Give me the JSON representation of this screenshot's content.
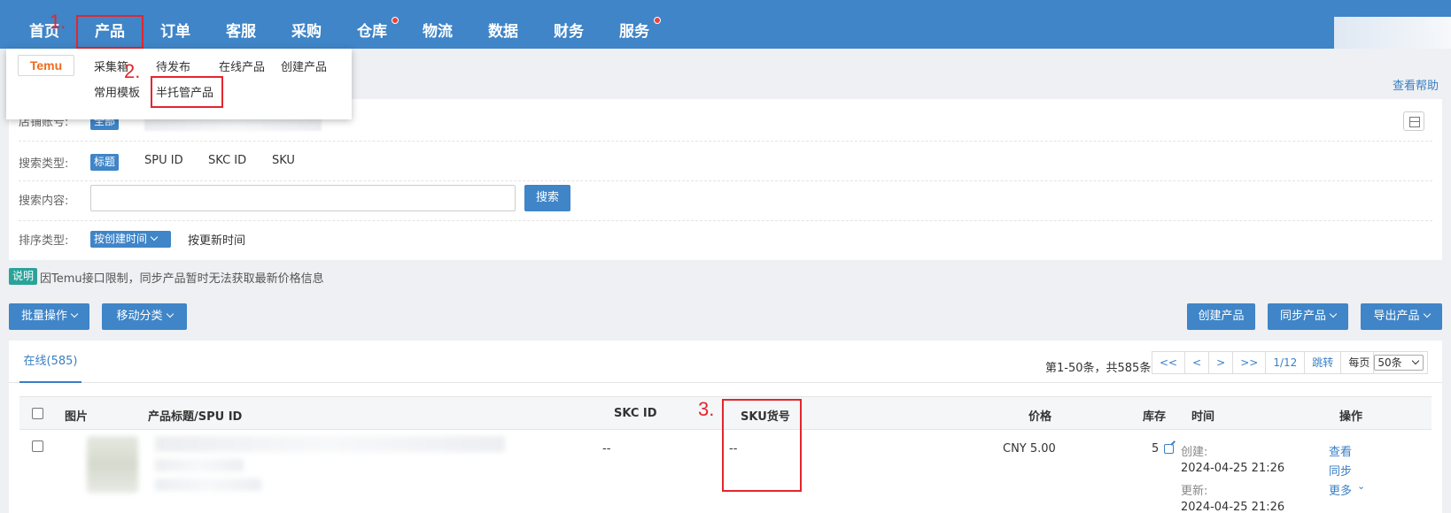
{
  "nav": {
    "items": [
      "首页",
      "产品",
      "订单",
      "客服",
      "采购",
      "仓库",
      "物流",
      "数据",
      "财务",
      "服务"
    ],
    "dots": [
      "仓库",
      "服务"
    ]
  },
  "annotations": [
    "1.",
    "2.",
    "3."
  ],
  "dropdown": {
    "platform_logo": "Temu",
    "row1": [
      "采集箱",
      "待发布",
      "在线产品",
      "创建产品"
    ],
    "row2": [
      "常用模板",
      "半托管产品"
    ]
  },
  "help_link": "查看帮助",
  "filters": {
    "shop_label": "店铺账号:",
    "shop_selected": "全部",
    "search_type_label": "搜索类型:",
    "search_types": [
      "标题",
      "SPU ID",
      "SKC ID",
      "SKU"
    ],
    "search_content_label": "搜索内容:",
    "search_value": "",
    "search_button": "搜索",
    "sort_label": "排序类型:",
    "sort_active": "按创建时间",
    "sort_other": "按更新时间"
  },
  "note": {
    "badge": "说明",
    "text": "因Temu接口限制，同步产品暂时无法获取最新价格信息"
  },
  "toolbar": {
    "batch": "批量操作",
    "move": "移动分类",
    "create": "创建产品",
    "sync": "同步产品",
    "export": "导出产品"
  },
  "tabs": {
    "online": "在线(585)"
  },
  "pagination": {
    "info": "第1-50条，共585条",
    "first": "<<",
    "prev": "<",
    "next": ">",
    "last": ">>",
    "page": "1/12",
    "jump": "跳转",
    "per_page_label": "每页",
    "per_page": "50条"
  },
  "table": {
    "headers": [
      "图片",
      "产品标题/SPU ID",
      "SKC ID",
      "SKU货号",
      "价格",
      "库存",
      "时间",
      "操作"
    ],
    "rows": [
      {
        "skc": "--",
        "sku": "--",
        "price": "CNY 5.00",
        "stock": "5",
        "created_label": "创建:",
        "created": "2024-04-25 21:26",
        "updated_label": "更新:",
        "updated": "2024-04-25 21:26",
        "actions": [
          "查看",
          "同步",
          "更多"
        ]
      }
    ]
  },
  "colors": {
    "nav_bg": "#3f85c8",
    "accent": "#3a7fc4",
    "annotation": "#e3262d",
    "note_badge": "#2aa39a"
  }
}
